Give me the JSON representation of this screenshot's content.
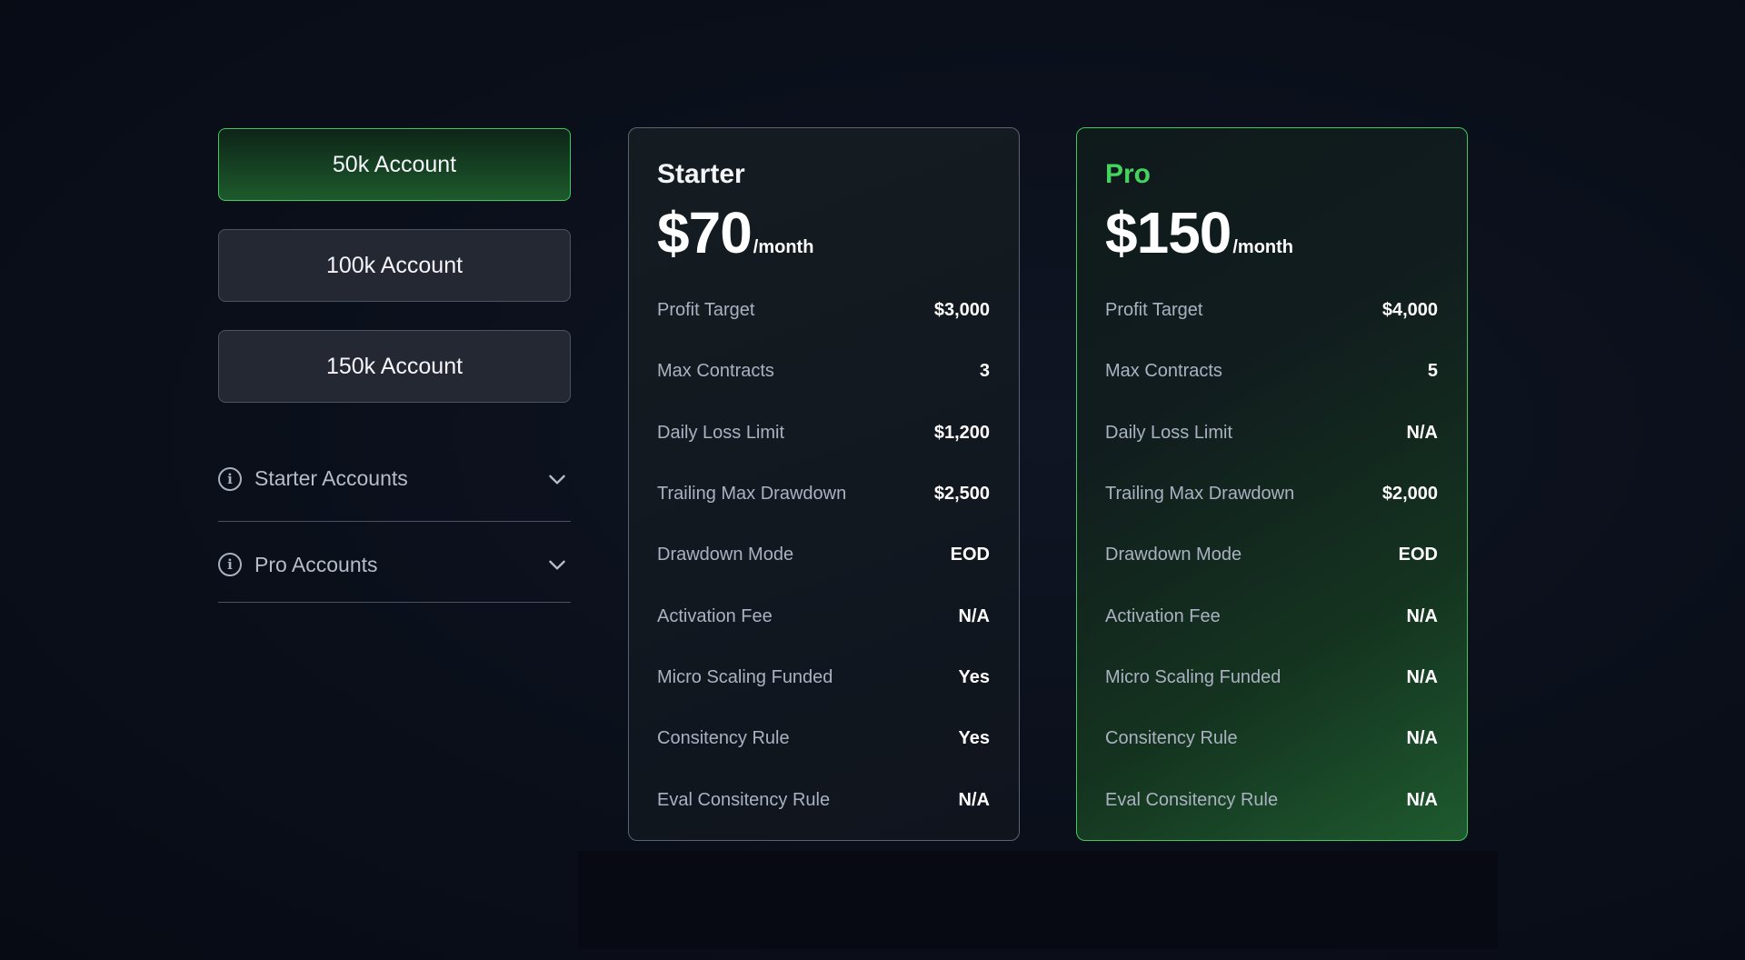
{
  "accounts": [
    {
      "label": "50k Account",
      "active": true
    },
    {
      "label": "100k Account",
      "active": false
    },
    {
      "label": "150k Account",
      "active": false
    }
  ],
  "accordions": [
    {
      "label": "Starter Accounts",
      "icon": "info-icon"
    },
    {
      "label": "Pro Accounts",
      "icon": "info-icon"
    }
  ],
  "plans": {
    "starter": {
      "name": "Starter",
      "price": "$70",
      "period": "/month",
      "rows": [
        {
          "label": "Profit Target",
          "value": "$3,000"
        },
        {
          "label": "Max Contracts",
          "value": "3"
        },
        {
          "label": "Daily Loss Limit",
          "value": "$1,200"
        },
        {
          "label": "Trailing Max Drawdown",
          "value": "$2,500"
        },
        {
          "label": "Drawdown Mode",
          "value": "EOD"
        },
        {
          "label": "Activation Fee",
          "value": "N/A"
        },
        {
          "label": "Micro Scaling Funded",
          "value": "Yes"
        },
        {
          "label": "Consitency Rule",
          "value": "Yes"
        },
        {
          "label": "Eval Consitency Rule",
          "value": "N/A"
        }
      ]
    },
    "pro": {
      "name": "Pro",
      "price": "$150",
      "period": "/month",
      "rows": [
        {
          "label": "Profit Target",
          "value": "$4,000"
        },
        {
          "label": "Max Contracts",
          "value": "5"
        },
        {
          "label": "Daily Loss Limit",
          "value": "N/A"
        },
        {
          "label": "Trailing Max Drawdown",
          "value": "$2,000"
        },
        {
          "label": "Drawdown Mode",
          "value": "EOD"
        },
        {
          "label": "Activation Fee",
          "value": "N/A"
        },
        {
          "label": "Micro Scaling Funded",
          "value": "N/A"
        },
        {
          "label": "Consitency Rule",
          "value": "N/A"
        },
        {
          "label": "Eval Consitency Rule",
          "value": "N/A"
        }
      ]
    }
  },
  "colors": {
    "accent_green": "#3fca5e",
    "pro_title": "#43d35e",
    "background": "#090e18"
  }
}
